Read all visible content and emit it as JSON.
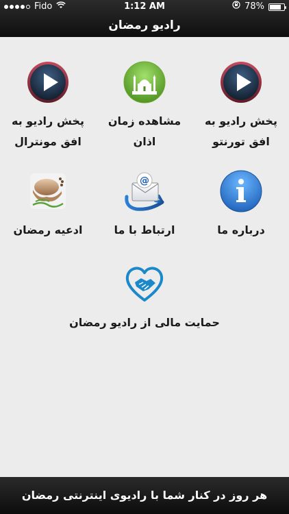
{
  "status": {
    "carrier": "Fido",
    "time": "1:12 AM",
    "battery": "78%",
    "battery_level": 0.78
  },
  "header": {
    "title": "رادیو رمضان"
  },
  "grid": {
    "items": [
      {
        "label": "پخش رادیو به افق تورنتو",
        "icon": "play-icon"
      },
      {
        "label": "مشاهده زمان اذان",
        "icon": "mosque-icon"
      },
      {
        "label": "پخش رادیو به افق مونترال",
        "icon": "play-icon"
      },
      {
        "label": "درباره ما",
        "icon": "info-icon"
      },
      {
        "label": "ارتباط با ما",
        "icon": "email-icon"
      },
      {
        "label": "ادعیه رمضان",
        "icon": "prayer-icon"
      },
      {
        "label": "حمایت مالی از رادیو رمضان",
        "icon": "donation-heart-icon"
      }
    ]
  },
  "footer": {
    "text": "هر روز در کنار شما با رادیوی اینترنتی رمضان"
  },
  "colors": {
    "bar_dark": "#111111",
    "content_bg": "#ececec",
    "play_bg": "#22364f",
    "mosque_green": "#78c23a",
    "info_blue": "#2f74c5",
    "heart_blue": "#1a88c9"
  }
}
